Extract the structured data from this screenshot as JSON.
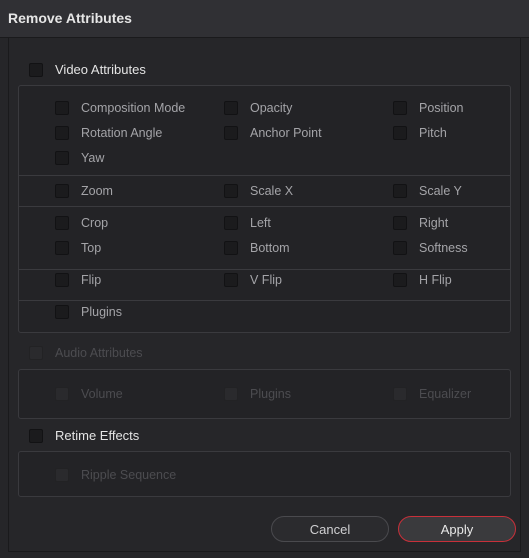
{
  "dialog": {
    "title": "Remove Attributes"
  },
  "video": {
    "label": "Video Attributes",
    "g1": [
      "Composition Mode",
      "Opacity",
      "Position",
      "Rotation Angle",
      "Anchor Point",
      "Pitch",
      "Yaw"
    ],
    "g2": [
      "Zoom",
      "Scale X",
      "Scale Y"
    ],
    "g3": [
      "Crop",
      "Left",
      "Right",
      "Top",
      "Bottom",
      "Softness"
    ],
    "g4": [
      "Flip",
      "V Flip",
      "H Flip"
    ],
    "g5": [
      "Plugins"
    ]
  },
  "audio": {
    "label": "Audio Attributes",
    "items": [
      "Volume",
      "Plugins",
      "Equalizer"
    ]
  },
  "retime": {
    "label": "Retime Effects",
    "items": [
      "Ripple Sequence"
    ]
  },
  "buttons": {
    "cancel": "Cancel",
    "apply": "Apply"
  },
  "colors": {
    "accent_border": "#c8303a",
    "background": "#262629"
  }
}
